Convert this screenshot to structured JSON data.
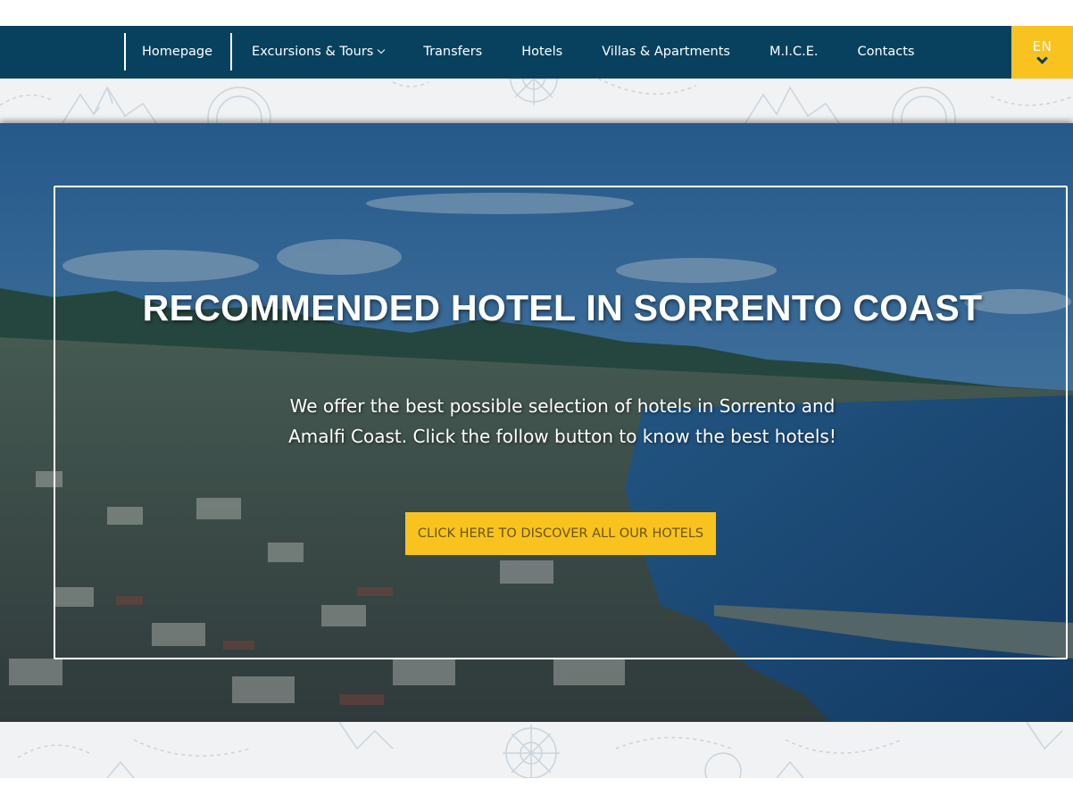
{
  "nav": {
    "items": [
      {
        "label": "Homepage"
      },
      {
        "label": "Excursions & Tours",
        "has_dropdown": true
      },
      {
        "label": "Transfers"
      },
      {
        "label": "Hotels"
      },
      {
        "label": "Villas & Apartments"
      },
      {
        "label": "M.I.C.E."
      },
      {
        "label": "Contacts"
      }
    ],
    "language": "EN"
  },
  "hero": {
    "title": "RECOMMENDED HOTEL IN SORRENTO COAST",
    "text": "We offer the best possible selection of hotels in Sorrento and Amalfi Coast. Click the follow button to know the best hotels!",
    "button_label": "CLICK HERE TO DISCOVER ALL OUR HOTELS"
  },
  "colors": {
    "navbar": "#07415e",
    "accent": "#f9c31f",
    "pattern_bg": "#f1f2f3"
  },
  "icons": [
    "chevron-down-icon",
    "language-chevron-icon"
  ]
}
